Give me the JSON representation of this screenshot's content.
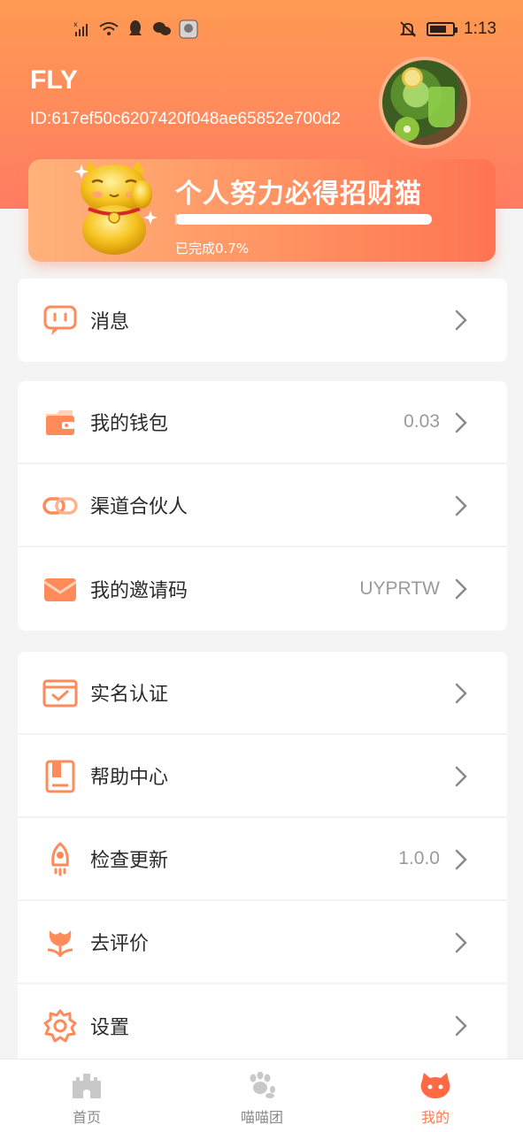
{
  "status_bar": {
    "time": "1:13",
    "icons": [
      "no-sim-signal-icon",
      "wifi-icon",
      "qq-icon",
      "wechat-icon",
      "app-avatar-icon",
      "bell-muted-icon",
      "battery-icon"
    ]
  },
  "profile": {
    "name": "FLY",
    "id_text": "ID:617ef50c6207420f048ae65852e700d2"
  },
  "lucky_cat": {
    "title": "个人努力必得招财猫",
    "progress_text": "已完成0.7%",
    "progress_fraction": 0.007
  },
  "menu": {
    "messages": {
      "label": "消息",
      "icon": "message-icon"
    },
    "wallet": {
      "label": "我的钱包",
      "value": "0.03",
      "icon": "wallet-icon"
    },
    "partner": {
      "label": "渠道合伙人",
      "icon": "link-icon"
    },
    "invite": {
      "label": "我的邀请码",
      "value": "UYPRTW",
      "icon": "envelope-icon"
    },
    "realname": {
      "label": "实名认证",
      "icon": "id-card-icon"
    },
    "help": {
      "label": "帮助中心",
      "icon": "book-icon"
    },
    "update": {
      "label": "检查更新",
      "value": "1.0.0",
      "icon": "rocket-icon"
    },
    "rate": {
      "label": "去评价",
      "icon": "flower-icon"
    },
    "settings": {
      "label": "设置",
      "icon": "gear-icon"
    }
  },
  "bottom_nav": {
    "home": "首页",
    "team": "喵喵团",
    "mine": "我的"
  },
  "colors": {
    "accent": "#ff7d4e",
    "header_gradient_top": "#ff9a52",
    "header_gradient_bottom": "#ff7c63"
  }
}
